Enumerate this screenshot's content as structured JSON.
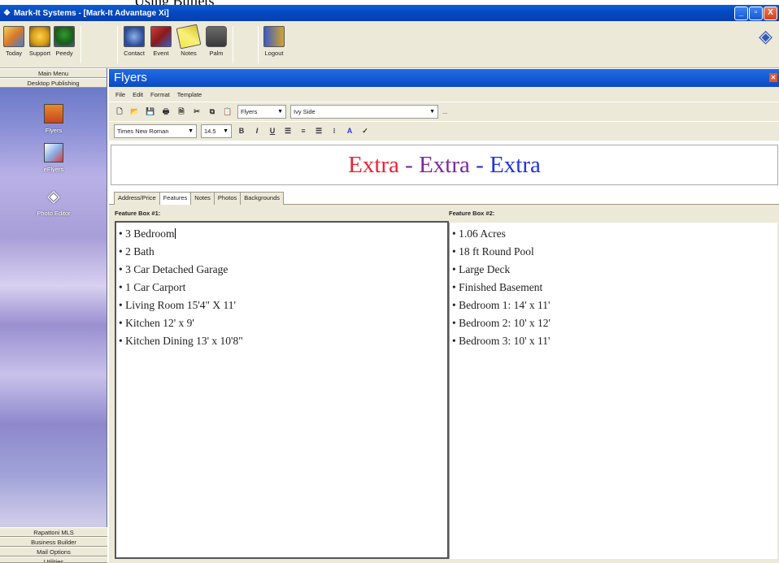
{
  "page_caption": "Using Bullets",
  "window": {
    "title": "Mark-It Systems - [Mark-It Advantage Xi]",
    "buttons": [
      "_",
      "▫",
      "X"
    ]
  },
  "toolbar": {
    "items": [
      {
        "label": "Today",
        "icon": "calendar-icon"
      },
      {
        "label": "Support",
        "icon": "support-icon"
      },
      {
        "label": "Peedy",
        "icon": "peedy-icon"
      },
      {
        "label": "Contact",
        "icon": "contact-icon"
      },
      {
        "label": "Event",
        "icon": "event-icon"
      },
      {
        "label": "Notes",
        "icon": "notes-icon"
      },
      {
        "label": "Palm",
        "icon": "palm-icon"
      },
      {
        "label": "Logout",
        "icon": "logout-icon"
      }
    ]
  },
  "sidebar": {
    "headers": [
      "Main Menu",
      "Desktop Publishing"
    ],
    "items": [
      {
        "label": "Flyers",
        "icon": "flyers-icon"
      },
      {
        "label": "eFlyers",
        "icon": "eflyers-icon"
      },
      {
        "label": "Photo Editor",
        "icon": "photo-editor-icon"
      }
    ],
    "bottom_sections": [
      "Rapattoni MLS",
      "Business Builder",
      "Mail Options",
      "Utilities"
    ]
  },
  "panel": {
    "title": "Flyers",
    "menu": [
      "File",
      "Edit",
      "Format",
      "Template"
    ],
    "template_combo": "Flyers",
    "style_combo": "Ivy Side",
    "more_label": "...",
    "font_combo": "Times New Roman",
    "size_combo": "14.5",
    "format_buttons": [
      "B",
      "I",
      "U"
    ]
  },
  "headline": {
    "part1": "Extra",
    "sep1": " - ",
    "part2": "Extra",
    "sep2": " - ",
    "part3": "Extra"
  },
  "tabs": [
    "Address/Price",
    "Features",
    "Notes",
    "Photos",
    "Backgrounds"
  ],
  "active_tab": "Features",
  "feature_box_1": {
    "label": "Feature Box #1:",
    "lines": [
      "• 3 Bedroom",
      "• 2 Bath",
      "• 3 Car Detached Garage",
      "• 1 Car Carport",
      "• Living Room 15'4\" X 11'",
      "• Kitchen 12' x 9'",
      "• Kitchen Dining 13' x 10'8\""
    ]
  },
  "feature_box_2": {
    "label": "Feature Box #2:",
    "lines": [
      "• 1.06 Acres",
      "• 18 ft Round Pool",
      "• Large Deck",
      "• Finished Basement",
      "• Bedroom 1: 14' x 11'",
      "• Bedroom 2: 10' x 12'",
      "• Bedroom 3: 10' x 11'"
    ]
  },
  "colors": {
    "titlebar": "#0548c0",
    "headline_red": "#ee2233",
    "headline_purple": "#7a2a9a",
    "headline_blue": "#2233dd"
  }
}
